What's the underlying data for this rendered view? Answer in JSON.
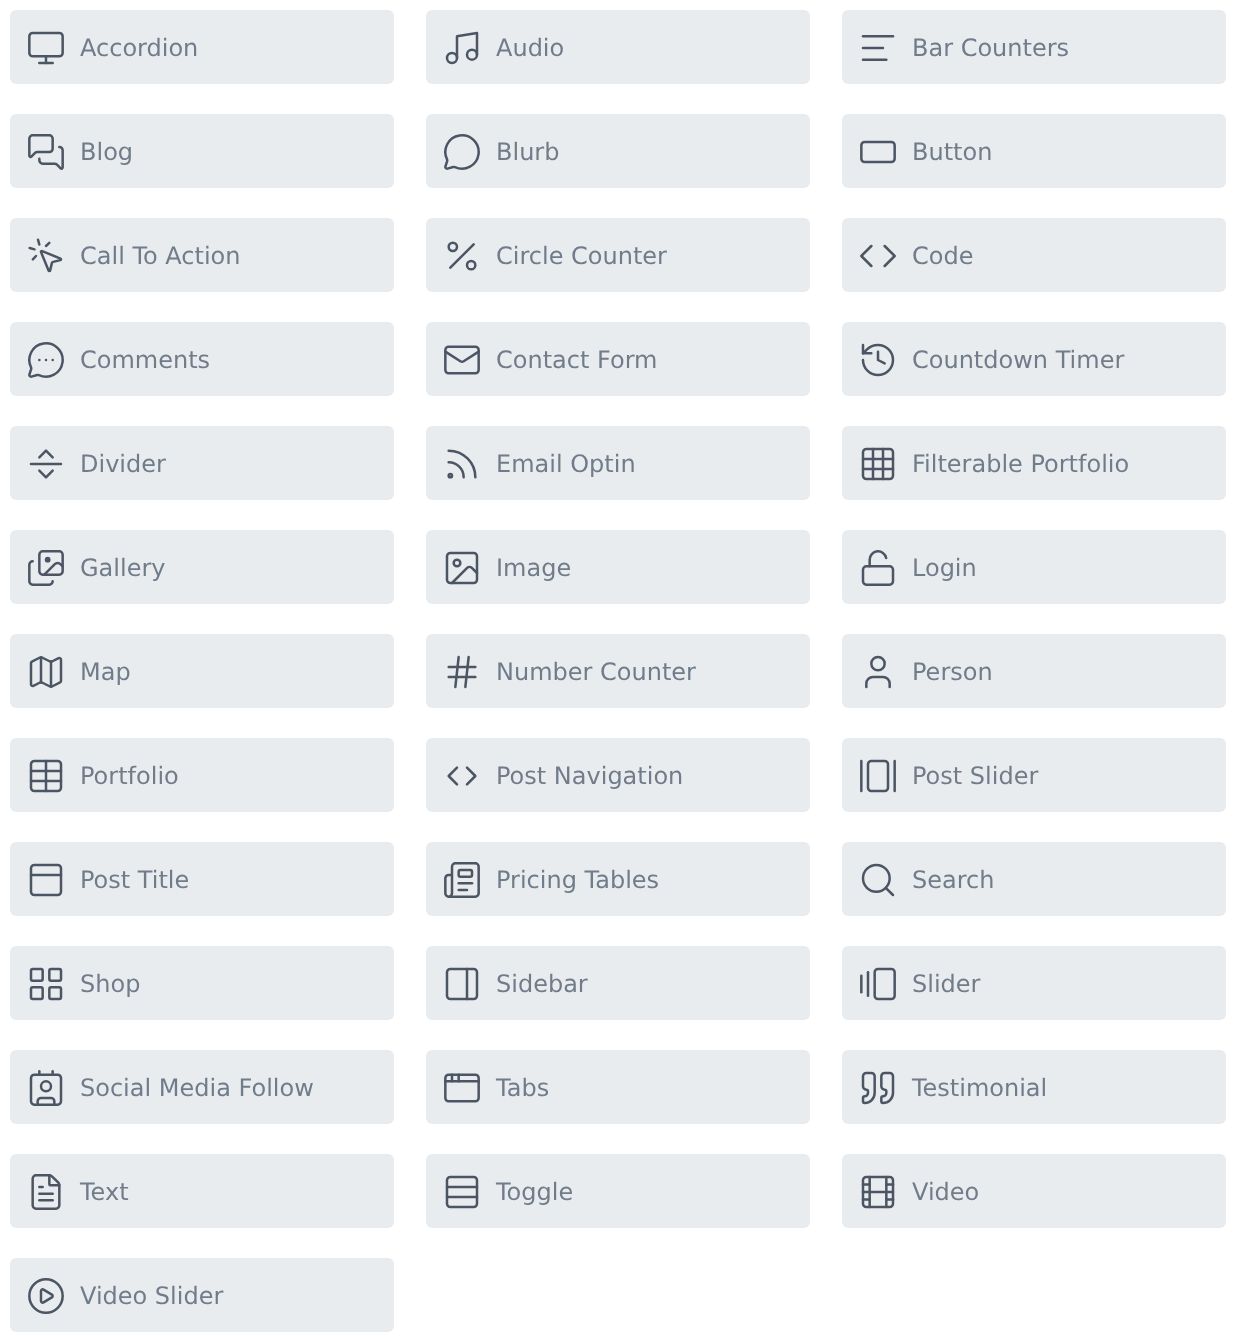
{
  "modules": [
    {
      "label": "Accordion"
    },
    {
      "label": "Audio"
    },
    {
      "label": "Bar Counters"
    },
    {
      "label": "Blog"
    },
    {
      "label": "Blurb"
    },
    {
      "label": "Button"
    },
    {
      "label": "Call To Action"
    },
    {
      "label": "Circle Counter"
    },
    {
      "label": "Code"
    },
    {
      "label": "Comments"
    },
    {
      "label": "Contact Form"
    },
    {
      "label": "Countdown Timer"
    },
    {
      "label": "Divider"
    },
    {
      "label": "Email Optin"
    },
    {
      "label": "Filterable Portfolio"
    },
    {
      "label": "Gallery"
    },
    {
      "label": "Image"
    },
    {
      "label": "Login"
    },
    {
      "label": "Map"
    },
    {
      "label": "Number Counter"
    },
    {
      "label": "Person"
    },
    {
      "label": "Portfolio"
    },
    {
      "label": "Post Navigation"
    },
    {
      "label": "Post Slider"
    },
    {
      "label": "Post Title"
    },
    {
      "label": "Pricing Tables"
    },
    {
      "label": "Search"
    },
    {
      "label": "Shop"
    },
    {
      "label": "Sidebar"
    },
    {
      "label": "Slider"
    },
    {
      "label": "Social Media Follow"
    },
    {
      "label": "Tabs"
    },
    {
      "label": "Testimonial"
    },
    {
      "label": "Text"
    },
    {
      "label": "Toggle"
    },
    {
      "label": "Video"
    },
    {
      "label": "Video Slider"
    }
  ]
}
